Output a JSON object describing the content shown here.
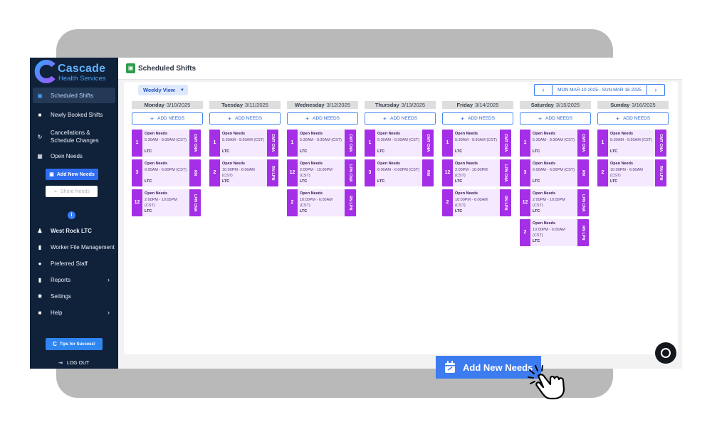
{
  "app": {
    "logo_name": "Cascade",
    "logo_sub": "Health Services",
    "brand_color": "#5fb2ff"
  },
  "sidebar": {
    "items": [
      {
        "label": "Scheduled Shifts",
        "icon": "calendar-icon",
        "active": true
      },
      {
        "label": "Newly Booked Shifts",
        "icon": "briefcase-icon"
      },
      {
        "label": "Cancellations & Schedule Changes",
        "icon": "refresh-icon"
      },
      {
        "label": "Open Needs",
        "icon": "calendar-grid-icon"
      }
    ],
    "add_button": "Add New Needs",
    "share_button": "Share Needs",
    "info_symbol": "i",
    "facility": "West Rock LTC",
    "items2": [
      {
        "label": "Worker File Management",
        "icon": "file-icon"
      },
      {
        "label": "Preferred Staff",
        "icon": "star-circle-icon"
      },
      {
        "label": "Reports",
        "icon": "report-icon",
        "chevron": "›"
      },
      {
        "label": "Settings",
        "icon": "gear-icon"
      },
      {
        "label": "Help",
        "icon": "help-icon",
        "chevron": "›"
      }
    ],
    "tips_button": "Tips for Success!",
    "logout": "LOG OUT"
  },
  "header": {
    "title": "Scheduled Shifts"
  },
  "toolbar": {
    "view_select": "Weekly View",
    "week_range": "MON MAR 10 2025 - SUN MAR 16 2025",
    "prev": "‹",
    "next": "›"
  },
  "add_needs_label": "ADD NEEDS",
  "days": [
    {
      "day": "Monday",
      "date": "3/10/2025",
      "shifts": [
        {
          "count": "1",
          "title": "Open Needs",
          "time": "5:30AM - 9:30AM (CST)",
          "loc": "LTC",
          "role": "CMT CNA"
        },
        {
          "count": "3",
          "title": "Open Needs",
          "time": "6:00AM - 6:00PM (CST)",
          "loc": "LTC",
          "role": "RN"
        },
        {
          "count": "12",
          "title": "Open Needs",
          "time": "2:00PM - 10:00PM (CST)",
          "loc": "LTC",
          "role": "LPN CNA"
        }
      ]
    },
    {
      "day": "Tuesday",
      "date": "3/11/2025",
      "shifts": [
        {
          "count": "1",
          "title": "Open Needs",
          "time": "5:30AM - 9:30AM (CST)",
          "loc": "LTC",
          "role": "CMT CNA"
        },
        {
          "count": "2",
          "title": "Open Needs",
          "time": "10:00PM - 6:00AM (CST)",
          "loc": "LTC",
          "role": "RN LPN"
        }
      ]
    },
    {
      "day": "Wednesday",
      "date": "3/12/2025",
      "shifts": [
        {
          "count": "1",
          "title": "Open Needs",
          "time": "5:30AM - 9:30AM (CST)",
          "loc": "LTC",
          "role": "CMT CNA"
        },
        {
          "count": "12",
          "title": "Open Needs",
          "time": "2:00PM - 10:00PM (CST)",
          "loc": "LTC",
          "role": "LPN CNA"
        },
        {
          "count": "2",
          "title": "Open Needs",
          "time": "10:00PM - 6:00AM (CST)",
          "loc": "LTC",
          "role": "RN LPN"
        }
      ]
    },
    {
      "day": "Thursday",
      "date": "3/13/2025",
      "shifts": [
        {
          "count": "1",
          "title": "Open Needs",
          "time": "5:30AM - 9:30AM (CST)",
          "loc": "LTC",
          "role": "CMT CNA"
        },
        {
          "count": "3",
          "title": "Open Needs",
          "time": "6:00AM - 6:00PM (CST)",
          "loc": "LTC",
          "role": "RN"
        }
      ]
    },
    {
      "day": "Friday",
      "date": "3/14/2025",
      "shifts": [
        {
          "count": "1",
          "title": "Open Needs",
          "time": "5:30AM - 9:30AM (CST)",
          "loc": "LTC",
          "role": "CMT CNA"
        },
        {
          "count": "12",
          "title": "Open Needs",
          "time": "2:00PM - 10:00PM (CST)",
          "loc": "LTC",
          "role": "LPN CNA"
        },
        {
          "count": "2",
          "title": "Open Needs",
          "time": "10:00PM - 6:00AM (CST)",
          "loc": "LTC",
          "role": "RN LPN"
        }
      ]
    },
    {
      "day": "Saturday",
      "date": "3/15/2025",
      "shifts": [
        {
          "count": "1",
          "title": "Open Needs",
          "time": "5:30AM - 9:30AM (CST)",
          "loc": "LTC",
          "role": "CMT CNA"
        },
        {
          "count": "3",
          "title": "Open Needs",
          "time": "6:00AM - 6:00PM (CST)",
          "loc": "LTC",
          "role": "RN"
        },
        {
          "count": "12",
          "title": "Open Needs",
          "time": "2:00PM - 10:00PM (CST)",
          "loc": "LTC",
          "role": "LPN CNA"
        },
        {
          "count": "2",
          "title": "Open Needs",
          "time": "10:00PM - 6:00AM (CST)",
          "loc": "LTC",
          "role": "RN LPN"
        }
      ]
    },
    {
      "day": "Sunday",
      "date": "3/16/2025",
      "shifts": [
        {
          "count": "1",
          "title": "Open Needs",
          "time": "5:30AM - 9:30AM (CST)",
          "loc": "LTC",
          "role": "CMT CNA"
        },
        {
          "count": "2",
          "title": "Open Needs",
          "time": "10:00PM - 6:00AM (CST)",
          "loc": "LTC",
          "role": "RN LPN"
        }
      ]
    }
  ],
  "callout": {
    "label": "Add New Needs",
    "icon": "calendar-add-icon"
  },
  "chat": {
    "icon": "chat-icon"
  },
  "cursor": {
    "icon": "hand-pointer-icon"
  },
  "colors": {
    "accent": "#3d7cf0",
    "shift_purple": "#a42fe6",
    "sidebar_bg": "#10213a"
  }
}
